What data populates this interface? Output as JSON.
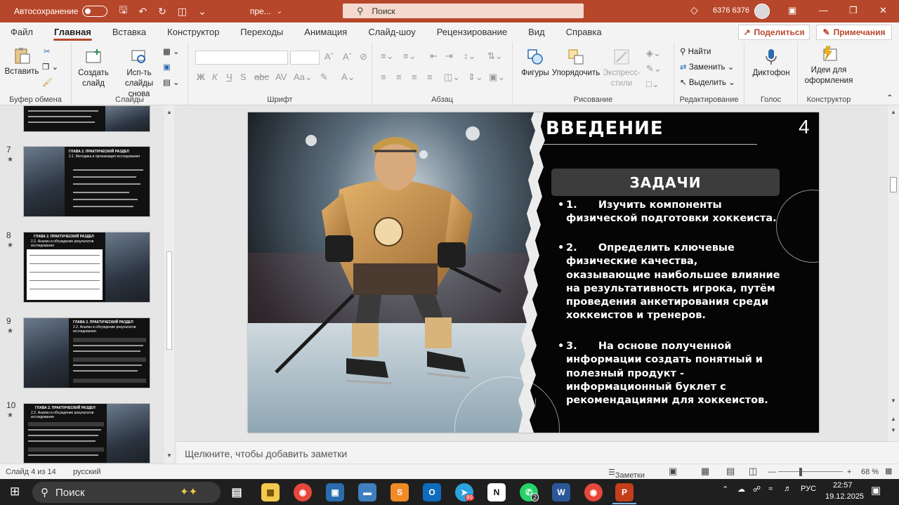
{
  "titlebar": {
    "autosave_label": "Автосохранение",
    "doc_name": "пре...",
    "search_placeholder": "Поиск",
    "user_name": "6376 6376"
  },
  "tabs": [
    {
      "label": "Файл"
    },
    {
      "label": "Главная",
      "active": true
    },
    {
      "label": "Вставка"
    },
    {
      "label": "Конструктор"
    },
    {
      "label": "Переходы"
    },
    {
      "label": "Анимация"
    },
    {
      "label": "Слайд-шоу"
    },
    {
      "label": "Рецензирование"
    },
    {
      "label": "Вид"
    },
    {
      "label": "Справка"
    }
  ],
  "share_label": "Поделиться",
  "comments_label": "Примечания",
  "ribbon": {
    "paste": "Вставить",
    "clipboard_group": "Буфер обмена",
    "new_slide": "Создать слайд",
    "reuse_slides": "Исп-ть слайды снова",
    "slides_group": "Слайды",
    "font_group": "Шрифт",
    "paragraph_group": "Абзац",
    "shapes": "Фигуры",
    "arrange": "Упорядочить",
    "quick_styles": "Экспресс-стили",
    "drawing_group": "Рисование",
    "find": "Найти",
    "replace": "Заменить",
    "select": "Выделить",
    "editing_group": "Редактирование",
    "dictaphone": "Диктофон",
    "voice_group": "Голос",
    "design_ideas": "Идеи для оформления",
    "designer_group": "Конструктор"
  },
  "thumbnails": [
    {
      "num": "7",
      "title": "ГЛАВА 2. ПРАКТИЧЕСКИЙ РАЗДЕЛ",
      "subtitle": "2.1. Методика и организация исследования"
    },
    {
      "num": "8",
      "title": "ГЛАВА 2. ПРАКТИЧЕСКИЙ РАЗДЕЛ",
      "subtitle": "2.2. Анализ и обсуждение результатов исследования"
    },
    {
      "num": "9",
      "title": "ГЛАВА 2. ПРАКТИЧЕСКИЙ РАЗДЕЛ",
      "subtitle": "2.2. Анализ и обсуждение результатов исследования"
    },
    {
      "num": "10",
      "title": "ГЛАВА 2. ПРАКТИЧЕСКИЙ РАЗДЕЛ",
      "subtitle": "2.2. Анализ и обсуждение результатов исследования"
    }
  ],
  "slide": {
    "title": "ВВЕДЕНИЕ",
    "number": "4",
    "tasks_heading": "ЗАДАЧИ",
    "tasks": [
      {
        "bullet": "•",
        "text": "1.      Изучить компоненты физической подготовки хоккеиста."
      },
      {
        "bullet": "•",
        "text": "2.      Определить ключевые физические качества, оказывающие наибольшее влияние на результативность игрока, путём проведения анкетирования среди хоккеистов и тренеров."
      },
      {
        "bullet": "•",
        "text": "3.      На основе полученной информации создать понятный и полезный продукт - информационный буклет с рекомендациями для хоккеистов."
      }
    ]
  },
  "notes_placeholder": "Щелкните, чтобы добавить заметки",
  "statusbar": {
    "slide_info": "Слайд 4 из 14",
    "language": "русский",
    "notes_btn": "Заметки",
    "zoom": "68 %"
  },
  "taskbar": {
    "search_label": "Поиск",
    "lang": "РУС",
    "time": "22:57",
    "date": "19.12.2025",
    "telegram_badge": "89",
    "whatsapp_badge": "2"
  },
  "colors": {
    "accent": "#b7472a",
    "slide_bg": "#050505"
  }
}
